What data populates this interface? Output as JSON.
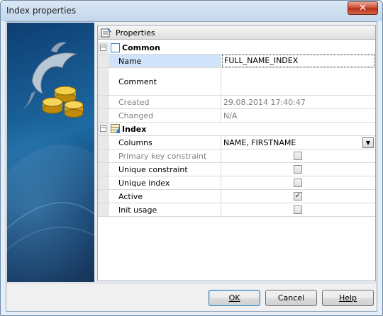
{
  "window": {
    "title": "Index properties",
    "close_glyph": "✕"
  },
  "panel": {
    "header_label": "Properties",
    "header_icon": "properties-icon"
  },
  "categories": {
    "common": {
      "label": "Common",
      "expander": "−"
    },
    "index": {
      "label": "Index",
      "expander": "−"
    }
  },
  "common_rows": {
    "name": {
      "label": "Name",
      "value": "FULL_NAME_INDEX"
    },
    "comment": {
      "label": "Comment",
      "value": ""
    },
    "created": {
      "label": "Created",
      "value": "29.08.2014 17:40:47"
    },
    "changed": {
      "label": "Changed",
      "value": "N/A"
    }
  },
  "index_rows": {
    "columns": {
      "label": "Columns",
      "value": "NAME, FIRSTNAME",
      "dropdown_glyph": "▼"
    },
    "primary_key": {
      "label": "Primary key constraint",
      "checked": false
    },
    "unique_constraint": {
      "label": "Unique constraint",
      "checked": false
    },
    "unique_index": {
      "label": "Unique index",
      "checked": false
    },
    "active": {
      "label": "Active",
      "checked": true,
      "check_glyph": "✓"
    },
    "init_usage": {
      "label": "Init usage",
      "checked": false
    }
  },
  "buttons": {
    "ok": "OK",
    "cancel": "Cancel",
    "help": "Help"
  },
  "colors": {
    "selection": "#cfe4fb",
    "accent": "#3c7fb1",
    "side_panel": "#1e6aa3",
    "close": "#c9452a"
  }
}
